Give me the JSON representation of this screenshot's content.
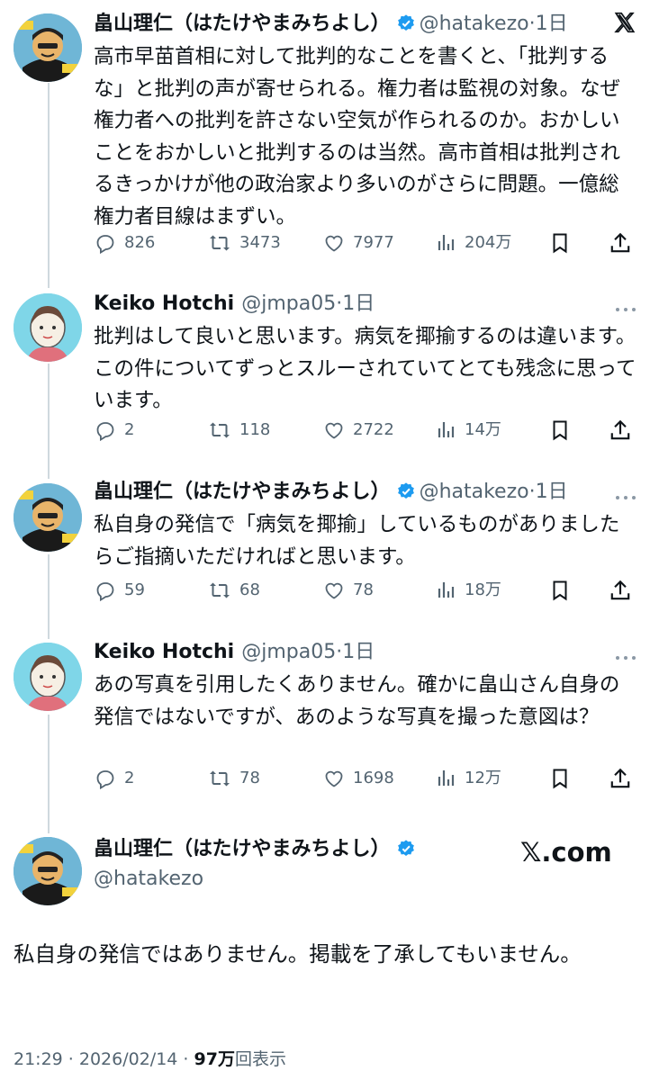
{
  "tweets": [
    {
      "name": "畠山理仁（はたけやまみちよし）",
      "handle": "@hatakezo",
      "time": "1日",
      "text": "高市早苗首相に対して批判的なことを書くと、「批判するな」と批判の声が寄せられる。権力者は監視の対象。なぜ権力者への批判を許さない空気が作られるのか。おかしいことをおかしいと批判するのは当然。高市首相は批判されるきっかけが他の政治家より多いのがさらに問題。一億総権力者目線はまずい。",
      "replies": "826",
      "reposts": "3473",
      "likes": "7977",
      "views": "204万"
    },
    {
      "name": "Keiko Hotchi",
      "handle": "@jmpa05",
      "time": "1日",
      "text": "批判はして良いと思います。病気を揶揄するのは違います。この件についてずっとスルーされていてとても残念に思っています。",
      "replies": "2",
      "reposts": "118",
      "likes": "2722",
      "views": "14万"
    },
    {
      "name": "畠山理仁（はたけやまみちよし）",
      "handle": "@hatakezo",
      "time": "1日",
      "text": "私自身の発信で「病気を揶揄」しているものがありましたらご指摘いただければと思います。",
      "replies": "59",
      "reposts": "68",
      "likes": "78",
      "views": "18万"
    },
    {
      "name": "Keiko Hotchi",
      "handle": "@jmpa05",
      "time": "1日",
      "text": "あの写真を引用したくありません。確かに畠山さん自身の発信ではないですが、あのような写真を撮った意図は？",
      "replies": "2",
      "reposts": "78",
      "likes": "1698",
      "views": "12万"
    }
  ],
  "main": {
    "name": "畠山理仁（はたけやまみちよし）",
    "handle": "@hatakezo",
    "text": "私自身の発信ではありません。掲載を了承してもいません。",
    "timestamp": "21:29 · 2026/02/14 · ",
    "views_count": "97万",
    "views_label": "回表示",
    "xcom": "𝕏.com"
  },
  "icons": {
    "reply": "reply-icon",
    "repost": "repost-icon",
    "like": "heart-icon",
    "views": "analytics-icon",
    "bookmark": "bookmark-icon",
    "share": "share-icon",
    "verified": "verified-badge-icon",
    "more": "more-icon",
    "x": "x-logo-icon"
  },
  "colors": {
    "verified": "#1d9bf0",
    "muted": "#536471",
    "thread_line": "#cfd9de"
  }
}
